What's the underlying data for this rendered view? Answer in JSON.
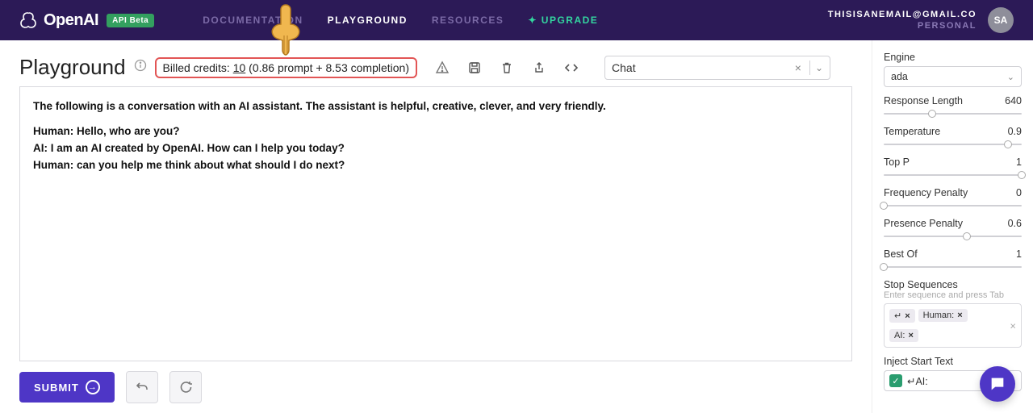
{
  "header": {
    "brand": "OpenAI",
    "api_badge": "API Beta",
    "nav": {
      "docs": "DOCUMENTATION",
      "playground": "PLAYGROUND",
      "resources": "RESOURCES",
      "upgrade": "UPGRADE"
    },
    "account": {
      "email": "THISISANEMAIL@GMAIL.CO",
      "type": "PERSONAL",
      "initials": "SA"
    }
  },
  "title": "Playground",
  "billed": {
    "prefix": "Billed credits: ",
    "total": "10",
    "detail": " (0.86 prompt + 8.53 completion)"
  },
  "preset": {
    "value": "Chat"
  },
  "editor": {
    "intro": "The following is a conversation with an AI assistant. The assistant is helpful, creative, clever, and very friendly.",
    "line1": "Human: Hello, who are you?",
    "line2": "AI: I am an AI created by OpenAI. How can I help you today?",
    "line3": "Human: can you help me think about what should I do next?"
  },
  "submit_label": "SUBMIT",
  "rightPanel": {
    "engine": {
      "label": "Engine",
      "value": "ada"
    },
    "response_length": {
      "label": "Response Length",
      "value": "640",
      "pct": 35
    },
    "temperature": {
      "label": "Temperature",
      "value": "0.9",
      "pct": 90
    },
    "top_p": {
      "label": "Top P",
      "value": "1",
      "pct": 100
    },
    "freq_penalty": {
      "label": "Frequency Penalty",
      "value": "0",
      "pct": 0
    },
    "pres_penalty": {
      "label": "Presence Penalty",
      "value": "0.6",
      "pct": 60
    },
    "best_of": {
      "label": "Best Of",
      "value": "1",
      "pct": 0
    },
    "stop": {
      "label": "Stop Sequences",
      "hint": "Enter sequence and press Tab",
      "tags": {
        "t0": "↵",
        "t1": "Human:",
        "t2": "AI:"
      }
    },
    "inject": {
      "label": "Inject Start Text",
      "value": "↵AI:"
    }
  }
}
